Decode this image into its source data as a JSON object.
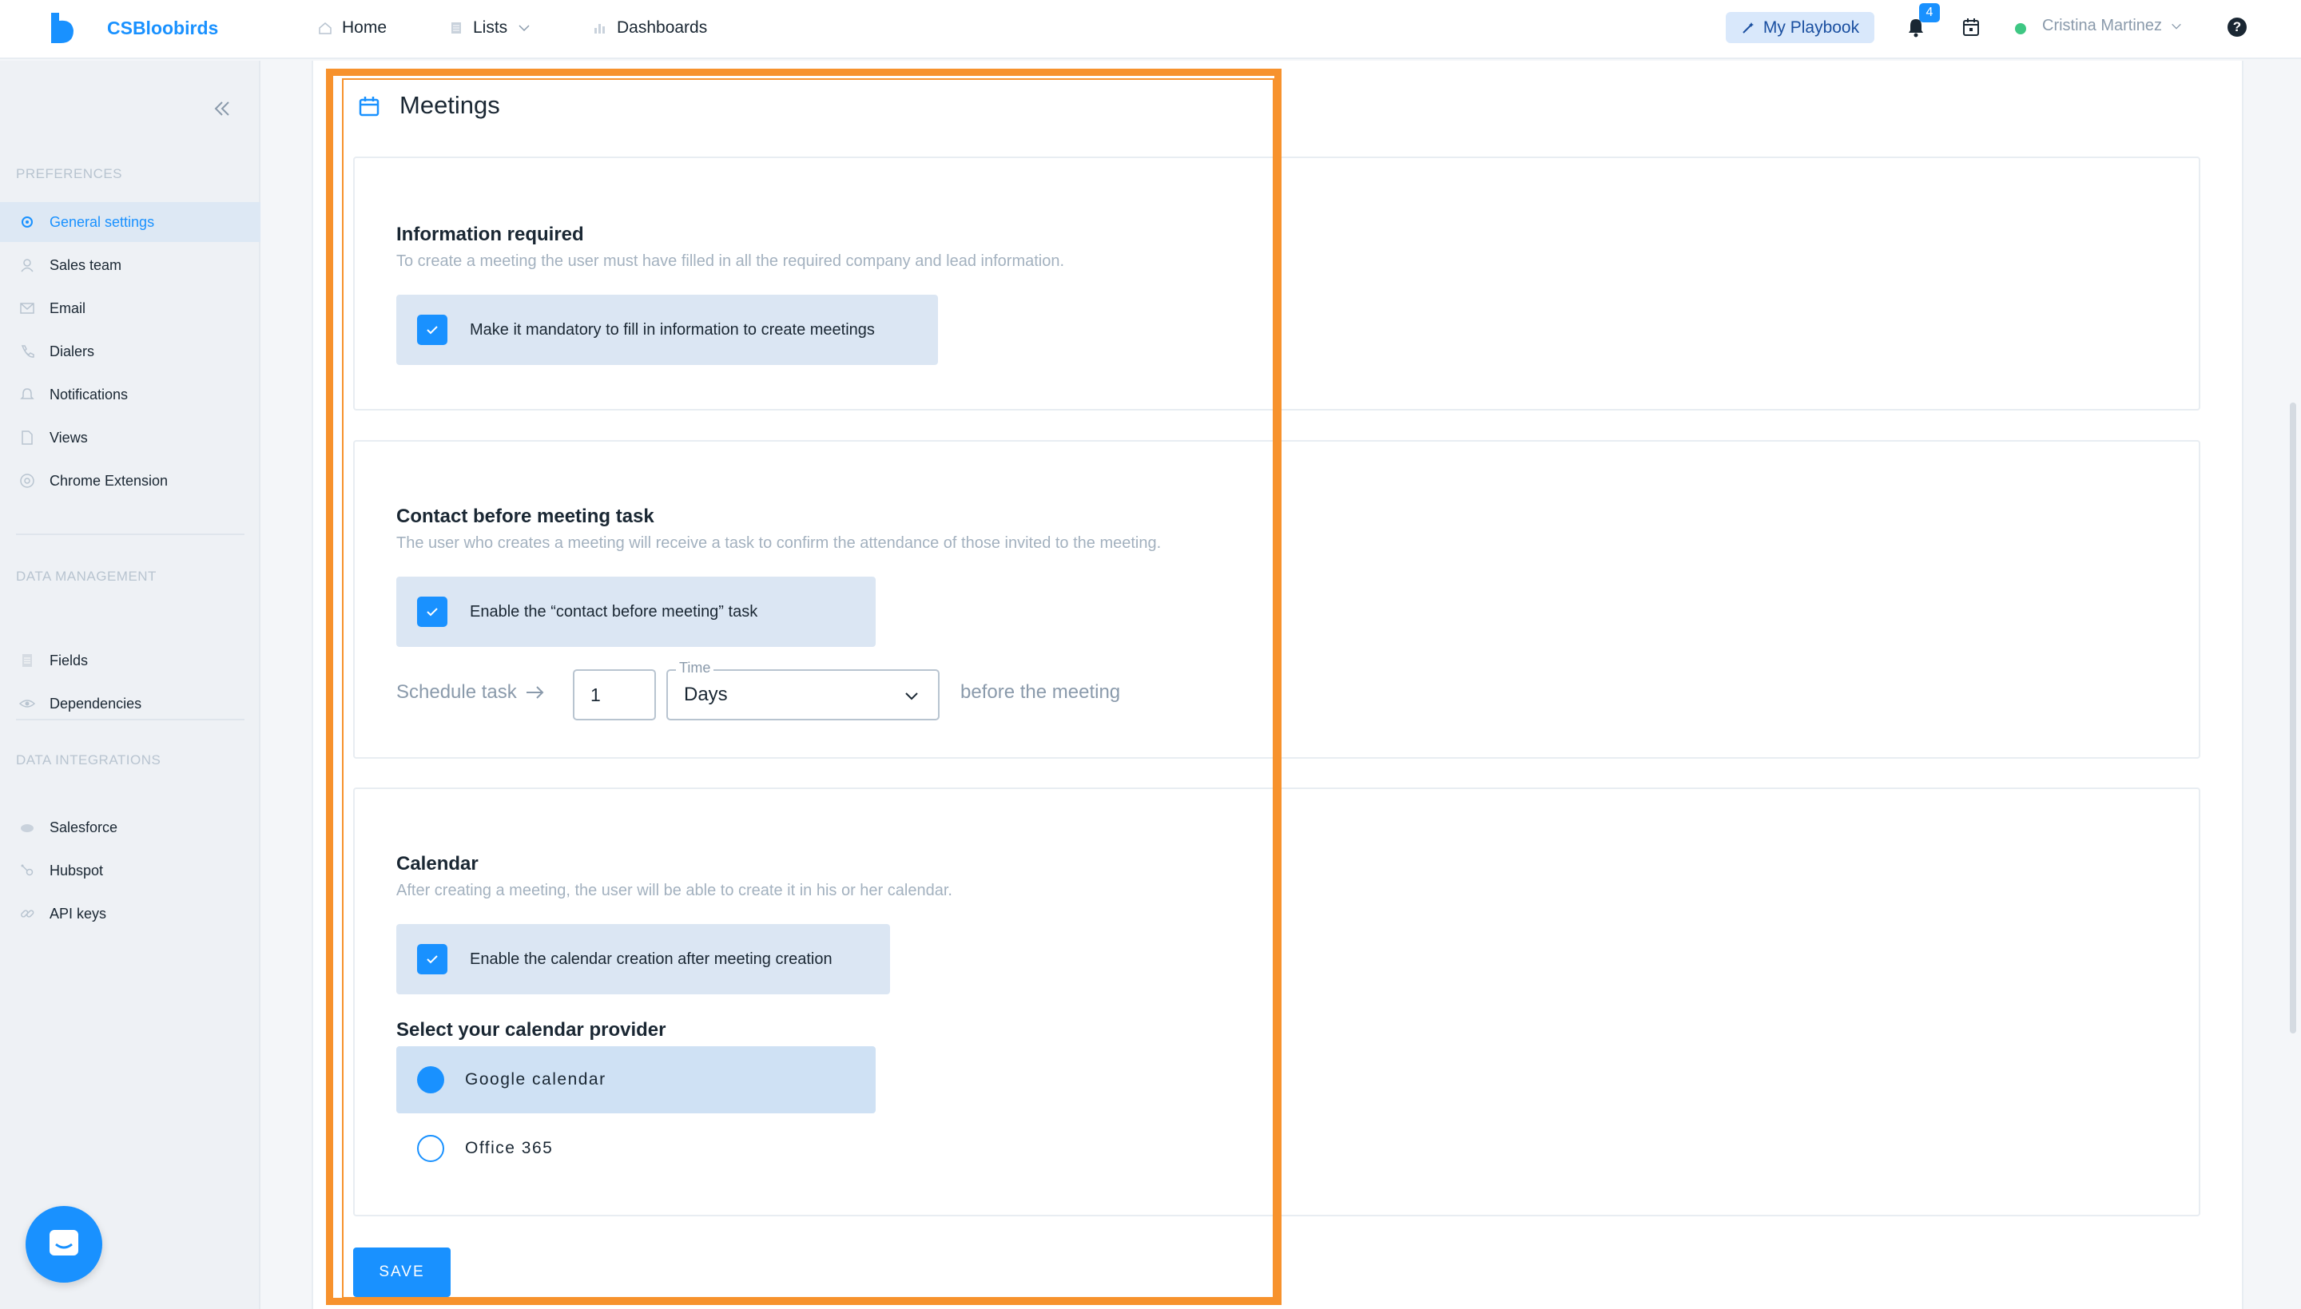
{
  "app": {
    "title": "CSBloobirds",
    "brand_color": "#1991ff"
  },
  "topnav": {
    "home": "Home",
    "lists": "Lists",
    "dashboards": "Dashboards",
    "playbook": "My Playbook",
    "notifications_count": "4",
    "user_name": "Cristina Martinez",
    "help": "?"
  },
  "sidebar": {
    "sections": [
      {
        "title": "PREFERENCES",
        "items": [
          {
            "label": "General settings",
            "icon": "gear-icon",
            "active": true
          },
          {
            "label": "Sales team",
            "icon": "user-icon"
          },
          {
            "label": "Email",
            "icon": "mail-icon"
          },
          {
            "label": "Dialers",
            "icon": "phone-icon"
          },
          {
            "label": "Notifications",
            "icon": "bell-icon"
          },
          {
            "label": "Views",
            "icon": "file-icon"
          },
          {
            "label": "Chrome Extension",
            "icon": "chrome-icon"
          }
        ]
      },
      {
        "title": "DATA MANAGEMENT",
        "items": [
          {
            "label": "Fields",
            "icon": "list-icon"
          },
          {
            "label": "Dependencies",
            "icon": "eye-icon"
          }
        ]
      },
      {
        "title": "DATA INTEGRATIONS",
        "items": [
          {
            "label": "Salesforce",
            "icon": "cloud-icon"
          },
          {
            "label": "Hubspot",
            "icon": "hubspot-icon"
          },
          {
            "label": "API keys",
            "icon": "link-icon"
          }
        ]
      }
    ]
  },
  "meetings": {
    "title": "Meetings",
    "info_required": {
      "title": "Information required",
      "subtitle": "To create a meeting the user must have filled in all the required company and lead information.",
      "checkbox_label": "Make it mandatory to fill in information to create meetings",
      "checked": true
    },
    "contact_before": {
      "title": "Contact before meeting task",
      "subtitle": "The user who creates a meeting will receive a task to confirm the attendance of those invited to the meeting.",
      "checkbox_label": "Enable the “contact before meeting” task",
      "checked": true,
      "schedule_label": "Schedule task",
      "schedule_value": "1",
      "time_label": "Time",
      "time_value": "Days",
      "suffix": "before the meeting"
    },
    "calendar": {
      "title": "Calendar",
      "subtitle": "After creating a meeting, the user will be able to create it in his or her calendar.",
      "checkbox_label": "Enable the calendar creation after meeting creation",
      "checked": true,
      "provider_title": "Select your calendar provider",
      "providers": [
        {
          "label": "Google calendar",
          "selected": true
        },
        {
          "label": "Office 365",
          "selected": false
        }
      ]
    },
    "save_label": "SAVE"
  },
  "highlight_color": "#f7922d"
}
